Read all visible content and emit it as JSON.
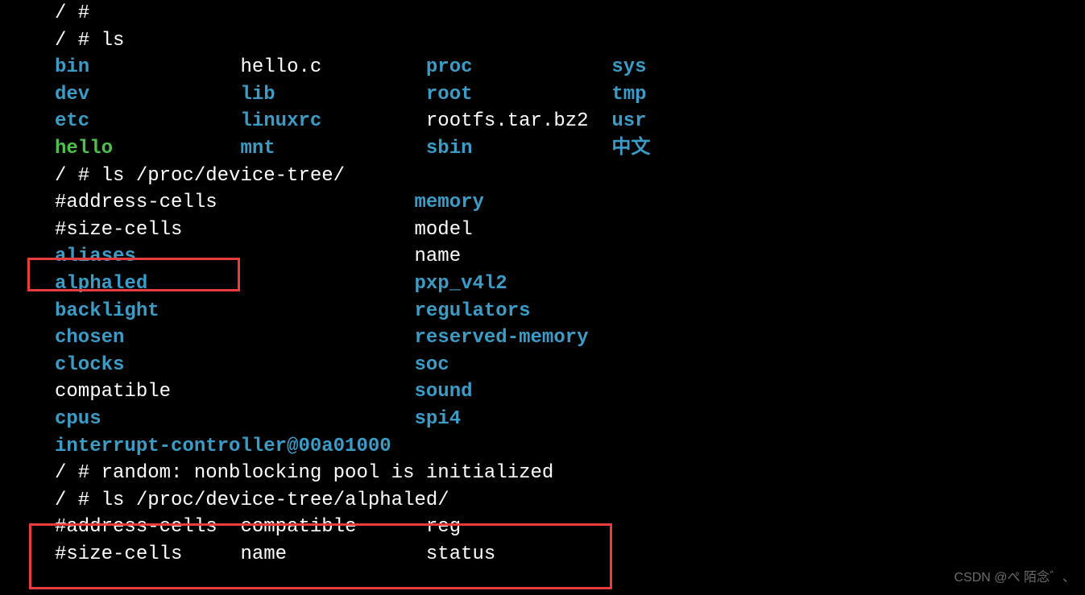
{
  "terminal": {
    "prompt0": "/ #",
    "prompt1": "/ # ls",
    "ls_root": {
      "col1": [
        {
          "text": "bin",
          "class": "cyan"
        },
        {
          "text": "dev",
          "class": "cyan"
        },
        {
          "text": "etc",
          "class": "cyan"
        },
        {
          "text": "hello",
          "class": "green"
        }
      ],
      "col2": [
        {
          "text": "hello.c",
          "class": "white"
        },
        {
          "text": "lib",
          "class": "cyan"
        },
        {
          "text": "linuxrc",
          "class": "cyan"
        },
        {
          "text": "mnt",
          "class": "cyan"
        }
      ],
      "col3": [
        {
          "text": "proc",
          "class": "cyan"
        },
        {
          "text": "root",
          "class": "cyan"
        },
        {
          "text": "rootfs.tar.bz2",
          "class": "white"
        },
        {
          "text": "sbin",
          "class": "cyan"
        }
      ],
      "col4": [
        {
          "text": "sys",
          "class": "cyan"
        },
        {
          "text": "tmp",
          "class": "cyan"
        },
        {
          "text": "usr",
          "class": "cyan"
        },
        {
          "text": "中文",
          "class": "cyan"
        }
      ]
    },
    "prompt2": "/ # ls /proc/device-tree/",
    "dt_col1": [
      {
        "text": "#address-cells",
        "class": "white"
      },
      {
        "text": "#size-cells",
        "class": "white"
      },
      {
        "text": "aliases",
        "class": "cyan"
      },
      {
        "text": "alphaled",
        "class": "cyan"
      },
      {
        "text": "backlight",
        "class": "cyan"
      },
      {
        "text": "chosen",
        "class": "cyan"
      },
      {
        "text": "clocks",
        "class": "cyan"
      },
      {
        "text": "compatible",
        "class": "white"
      },
      {
        "text": "cpus",
        "class": "cyan"
      },
      {
        "text": "interrupt-controller@00a01000",
        "class": "cyan"
      }
    ],
    "dt_col2": [
      {
        "text": "memory",
        "class": "cyan"
      },
      {
        "text": "model",
        "class": "white"
      },
      {
        "text": "name",
        "class": "white"
      },
      {
        "text": "pxp_v4l2",
        "class": "cyan"
      },
      {
        "text": "regulators",
        "class": "cyan"
      },
      {
        "text": "reserved-memory",
        "class": "cyan"
      },
      {
        "text": "soc",
        "class": "cyan"
      },
      {
        "text": "sound",
        "class": "cyan"
      },
      {
        "text": "spi4",
        "class": "cyan"
      }
    ],
    "random_msg": "/ # random: nonblocking pool is initialized",
    "blank": "",
    "prompt3": "/ # ls /proc/device-tree/alphaled/",
    "alpha_row1": {
      "c1": "#address-cells",
      "c2": "compatible",
      "c3": "reg"
    },
    "alpha_row2": {
      "c1": "#size-cells",
      "c2": "name",
      "c3": "status"
    }
  },
  "watermark": "CSDN @ぺ 陌念゛、"
}
